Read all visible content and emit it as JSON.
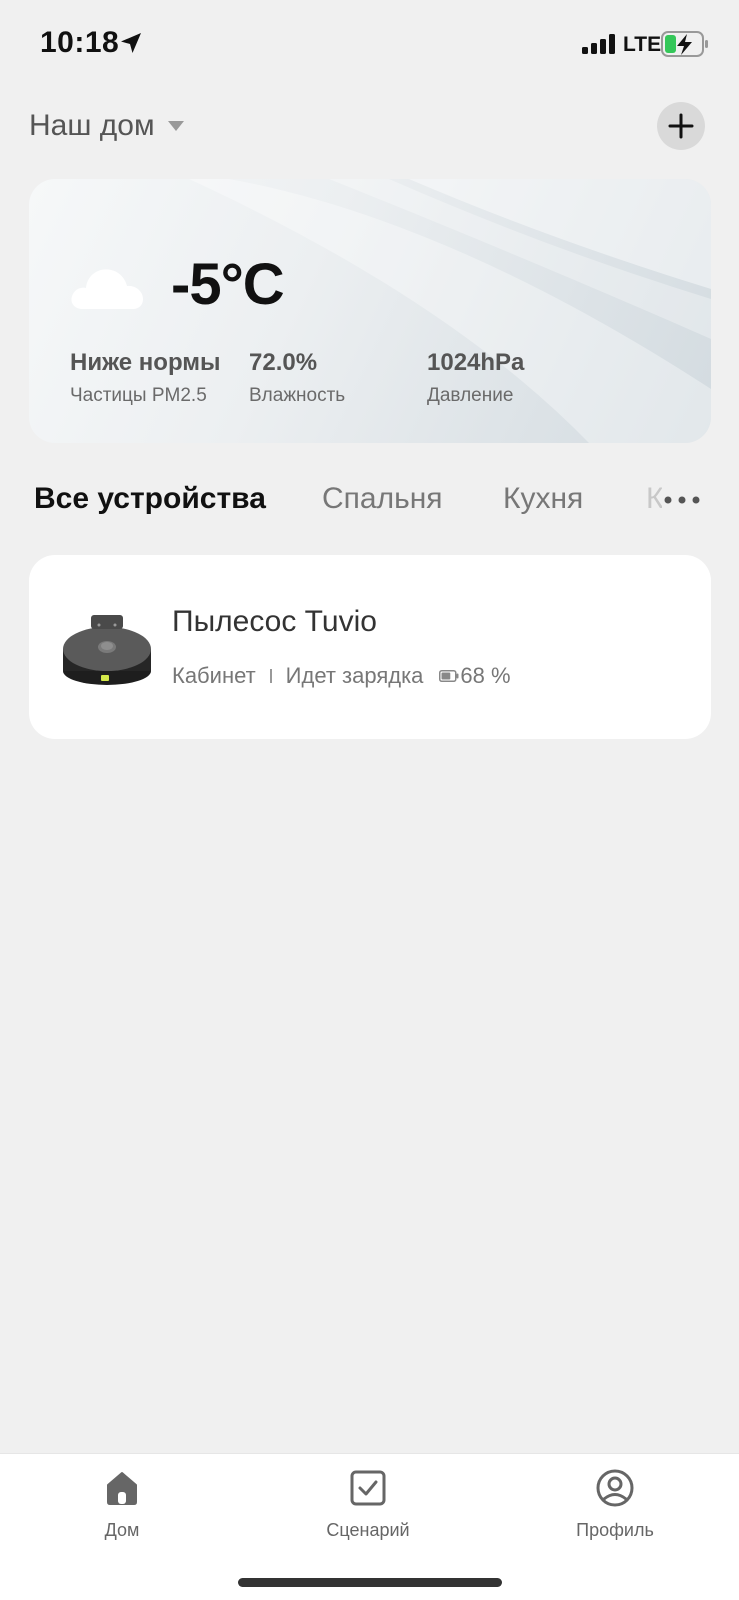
{
  "status_bar": {
    "time": "10:18",
    "network": "LTE",
    "location_icon": "location-arrow-icon",
    "signal_icon": "signal-bars-icon",
    "battery_icon": "battery-charging-icon"
  },
  "header": {
    "home_name": "Наш дом",
    "dropdown_icon": "caret-down-icon",
    "add_icon": "plus-icon"
  },
  "weather": {
    "icon": "cloud-icon",
    "temperature": "-5°C",
    "stats": [
      {
        "value": "Ниже нормы",
        "label": "Частицы PM2.5"
      },
      {
        "value": "72.0%",
        "label": "Влажность"
      },
      {
        "value": "1024hPa",
        "label": "Давление"
      }
    ]
  },
  "tabs": {
    "items": [
      "Все устройства",
      "Спальня",
      "Кухня",
      "К"
    ],
    "active_index": 0,
    "more_icon": "more-horizontal-icon"
  },
  "device": {
    "name": "Пылесос Tuvio",
    "room": "Кабинет",
    "status": "Идет зарядка",
    "battery": "68 %",
    "battery_level": 0.68,
    "image": "robot-vacuum-image"
  },
  "bottom_nav": {
    "items": [
      {
        "label": "Дом",
        "icon": "home-icon",
        "active": true
      },
      {
        "label": "Сценарий",
        "icon": "checkbox-icon",
        "active": false
      },
      {
        "label": "Профиль",
        "icon": "profile-icon",
        "active": false
      }
    ]
  },
  "colors": {
    "background": "#f0f0f0",
    "card": "#ffffff",
    "battery_green": "#34c759",
    "text_primary": "#111111",
    "text_secondary": "#777777"
  }
}
